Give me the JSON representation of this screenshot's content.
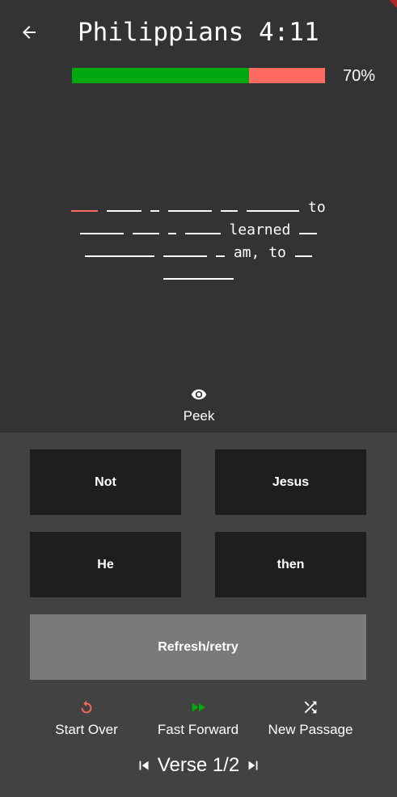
{
  "header": {
    "title": "Philippians 4:11",
    "back_icon": "arrow-left-icon"
  },
  "progress": {
    "fraction": 0.7,
    "label": "70%",
    "fill_color": "#00a80f",
    "remaining_color": "#ff6b61"
  },
  "verse": {
    "lines": [
      [
        {
          "blank": 3,
          "active": true
        },
        {
          "blank": 4
        },
        {
          "blank": 1
        },
        {
          "blank": 5
        },
        {
          "blank": 2
        },
        {
          "blank": 6
        },
        {
          "text": "to"
        }
      ],
      [
        {
          "blank": 5
        },
        {
          "blank": 3
        },
        {
          "blank": 1
        },
        {
          "blank": 4
        },
        {
          "text": "learned"
        },
        {
          "blank": 2
        }
      ],
      [
        {
          "blank": 8
        },
        {
          "blank": 5
        },
        {
          "blank": 1
        },
        {
          "text": "am,"
        },
        {
          "text": "to"
        },
        {
          "blank": 2
        }
      ],
      [
        {
          "blank": 8
        }
      ]
    ]
  },
  "peek": {
    "label": "Peek",
    "icon": "eye-icon"
  },
  "choices": {
    "top_left": "Not",
    "top_right": "Jesus",
    "bottom_left": "He",
    "bottom_right": "then"
  },
  "refresh_label": "Refresh/retry",
  "actions": {
    "start_over": {
      "label": "Start Over",
      "icon": "restart-icon",
      "color": "#ff6b61"
    },
    "fast_forward": {
      "label": "Fast Forward",
      "icon": "fast-forward-icon",
      "color": "#00a80f"
    },
    "new_passage": {
      "label": "New Passage",
      "icon": "shuffle-icon",
      "color": "#ffffff"
    }
  },
  "verse_nav": {
    "label": "Verse 1/2",
    "prev_icon": "skip-previous-icon",
    "next_icon": "skip-next-icon"
  }
}
